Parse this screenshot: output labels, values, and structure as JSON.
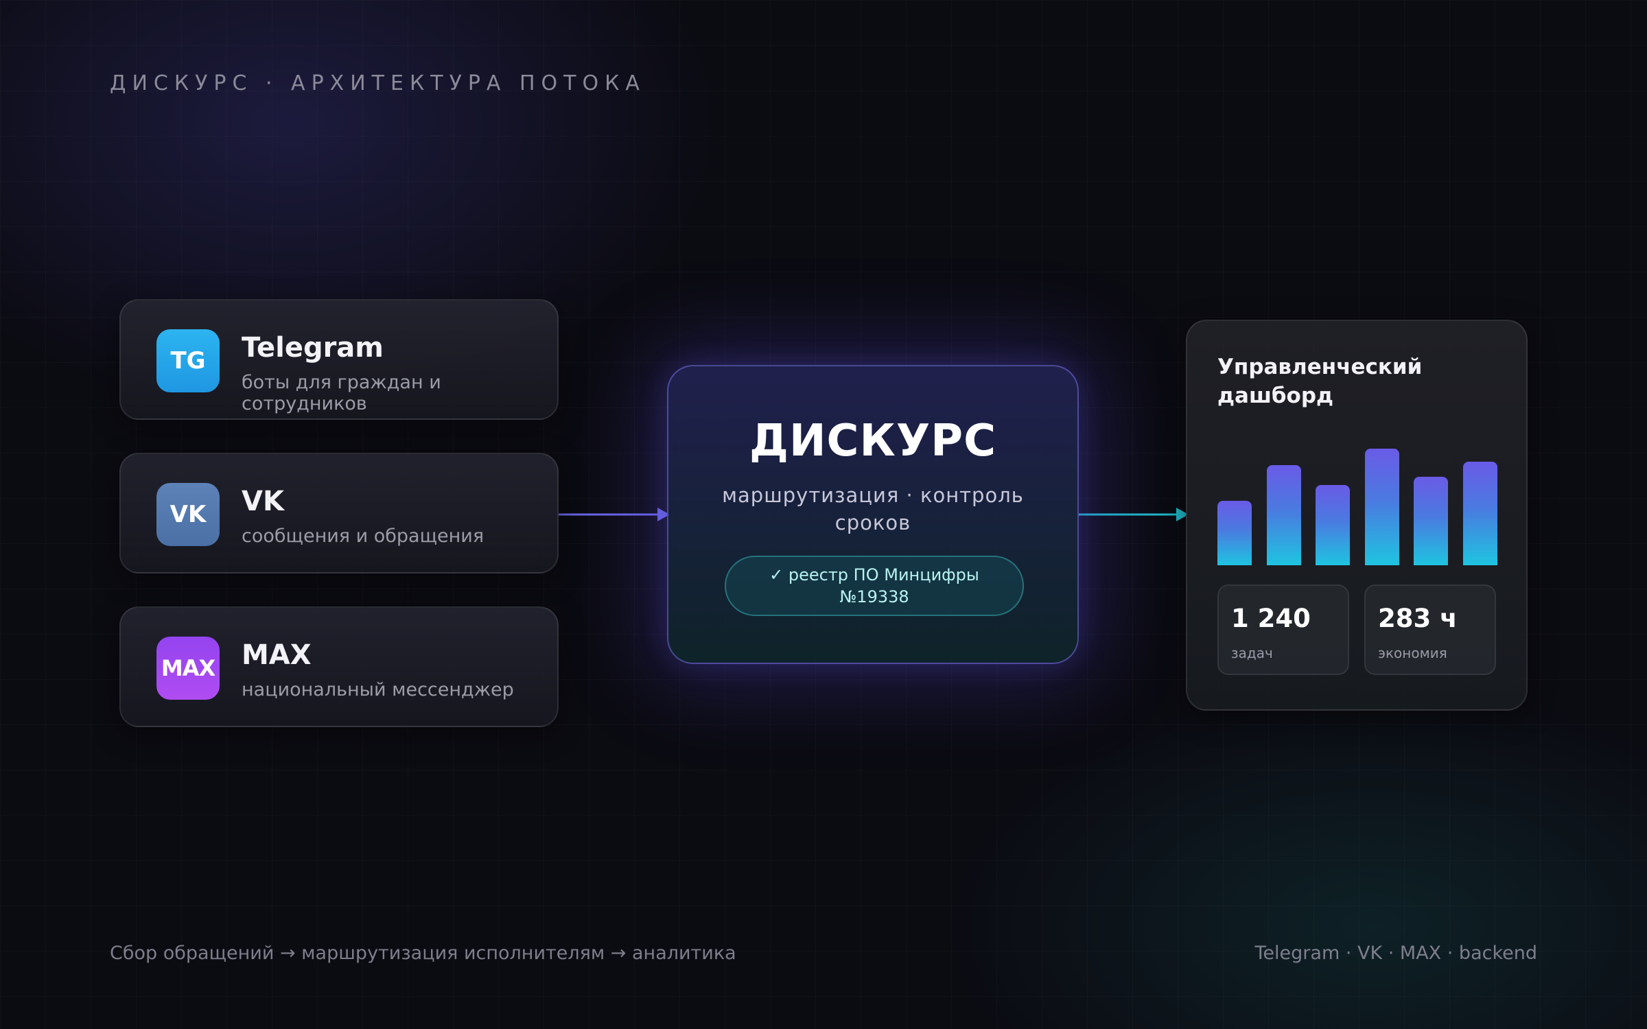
{
  "header": {
    "kicker": "ДИСКУРС · АРХИТЕКТУРА ПОТОКА"
  },
  "sources": [
    {
      "badge": "TG",
      "name": "Telegram",
      "subtitle": "боты для граждан и сотрудников",
      "color": "#2aabee"
    },
    {
      "badge": "VK",
      "name": "VK",
      "subtitle": "сообщения и обращения",
      "color": "#5181b8"
    },
    {
      "badge": "MAX",
      "name": "MAX",
      "subtitle": "национальный мессенджер",
      "color": "#a24af2"
    }
  ],
  "core": {
    "title": "ДИСКУРС",
    "subtitle": "маршрутизация · контроль сроков",
    "registry": "✓ реестр ПО Минцифры №19338"
  },
  "dashboard": {
    "title": "Управленческий дашборд",
    "bar_levels": [
      0.55,
      0.86,
      0.69,
      1.0,
      0.76,
      0.89
    ],
    "stats": [
      {
        "value": "1 240",
        "label": "задач"
      },
      {
        "value": "283 ч",
        "label": "экономия"
      }
    ]
  },
  "footer": {
    "left": "Сбор обращений → маршрутизация исполнителям → аналитика",
    "right": "Telegram · VK · MAX · backend"
  },
  "colors": {
    "accent_in": "#6b66e8",
    "accent_out": "#1fb8c9"
  }
}
